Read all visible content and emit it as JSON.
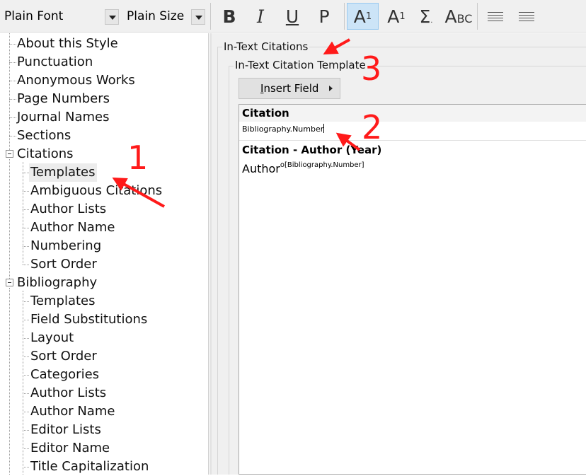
{
  "toolbar": {
    "font_value": "Plain Font",
    "size_value": "Plain Size",
    "buttons": {
      "bold": "B",
      "italic": "I",
      "underline": "U",
      "plain": "P",
      "superscript_base": "A",
      "superscript_mark": "1",
      "subscript_base": "A",
      "subscript_mark": "1",
      "symbol": "Σ",
      "smallcaps_a": "A",
      "smallcaps_rest": "BC"
    }
  },
  "tree": {
    "items": [
      {
        "label": "About this Style"
      },
      {
        "label": "Punctuation"
      },
      {
        "label": "Anonymous Works"
      },
      {
        "label": "Page Numbers"
      },
      {
        "label": "Journal Names"
      },
      {
        "label": "Sections"
      },
      {
        "label": "Citations"
      },
      {
        "label": "Templates"
      },
      {
        "label": "Ambiguous Citations"
      },
      {
        "label": "Author Lists"
      },
      {
        "label": "Author Name"
      },
      {
        "label": "Numbering"
      },
      {
        "label": "Sort Order"
      },
      {
        "label": "Bibliography"
      },
      {
        "label": "Templates"
      },
      {
        "label": "Field Substitutions"
      },
      {
        "label": "Layout"
      },
      {
        "label": "Sort Order"
      },
      {
        "label": "Categories"
      },
      {
        "label": "Author Lists"
      },
      {
        "label": "Author Name"
      },
      {
        "label": "Editor Lists"
      },
      {
        "label": "Editor Name"
      },
      {
        "label": "Title Capitalization"
      }
    ]
  },
  "panel": {
    "outer_group_title": "In-Text Citations",
    "inner_group_title": "In-Text Citation Template",
    "insert_field_first": "I",
    "insert_field_rest": "nsert Field",
    "editor": {
      "citation_label": "Citation",
      "citation_template": "Bibliography.Number",
      "author_label": "Citation - Author (Year)",
      "author_text": "Author",
      "author_sup": "o[Bibliography.Number]"
    }
  },
  "annotations": {
    "marker_1": "1",
    "marker_2": "2",
    "marker_3": "3",
    "color": "#ff1a1a"
  }
}
